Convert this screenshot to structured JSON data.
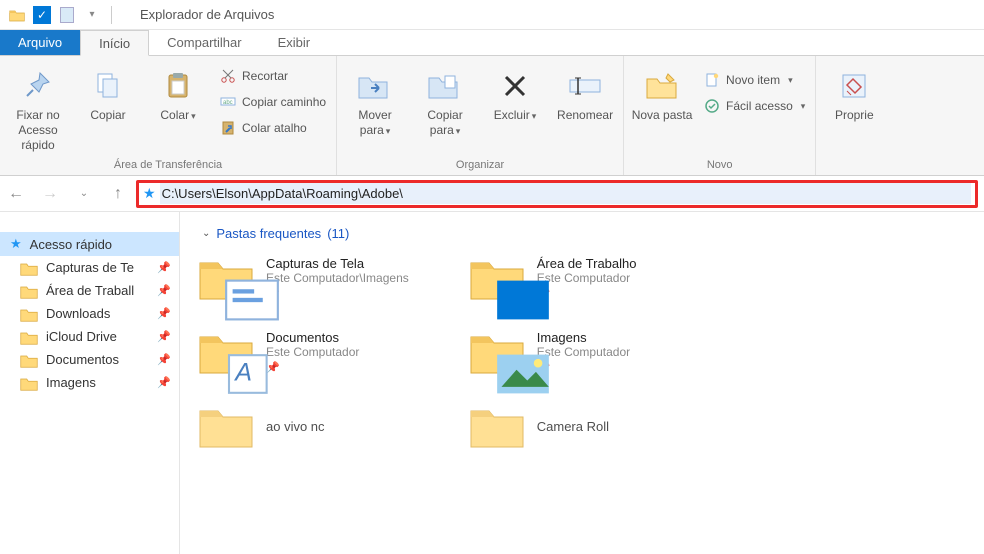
{
  "titlebar": {
    "title": "Explorador de Arquivos"
  },
  "tabs": {
    "file": "Arquivo",
    "home": "Início",
    "share": "Compartilhar",
    "view": "Exibir"
  },
  "ribbon": {
    "clipboard": {
      "pin": "Fixar no Acesso rápido",
      "copy": "Copiar",
      "paste": "Colar",
      "cut": "Recortar",
      "copypath": "Copiar caminho",
      "pasteshortcut": "Colar atalho",
      "label": "Área de Transferência"
    },
    "organize": {
      "moveto": "Mover para",
      "copyto": "Copiar para",
      "delete": "Excluir",
      "rename": "Renomear",
      "label": "Organizar"
    },
    "new": {
      "newfolder": "Nova pasta",
      "newitem": "Novo item",
      "easyaccess": "Fácil acesso",
      "label": "Novo"
    },
    "open": {
      "properties": "Proprie"
    }
  },
  "address": {
    "path": "C:\\Users\\Elson\\AppData\\Roaming\\Adobe\\"
  },
  "sidebar": {
    "quick": "Acesso rápido",
    "items": [
      {
        "label": "Capturas de Te"
      },
      {
        "label": "Área de Traball"
      },
      {
        "label": "Downloads"
      },
      {
        "label": "iCloud Drive"
      },
      {
        "label": "Documentos"
      },
      {
        "label": "Imagens"
      }
    ]
  },
  "content": {
    "section_label": "Pastas frequentes",
    "section_count": "(11)",
    "col1": [
      {
        "title": "Capturas de Tela",
        "sub": "Este Computador\\Imagens"
      },
      {
        "title": "Documentos",
        "sub": "Este Computador"
      },
      {
        "title": "ao vivo nc",
        "sub": ""
      }
    ],
    "col2": [
      {
        "title": "Área de Trabalho",
        "sub": "Este Computador"
      },
      {
        "title": "Imagens",
        "sub": "Este Computador"
      },
      {
        "title": "Camera Roll",
        "sub": ""
      }
    ]
  }
}
